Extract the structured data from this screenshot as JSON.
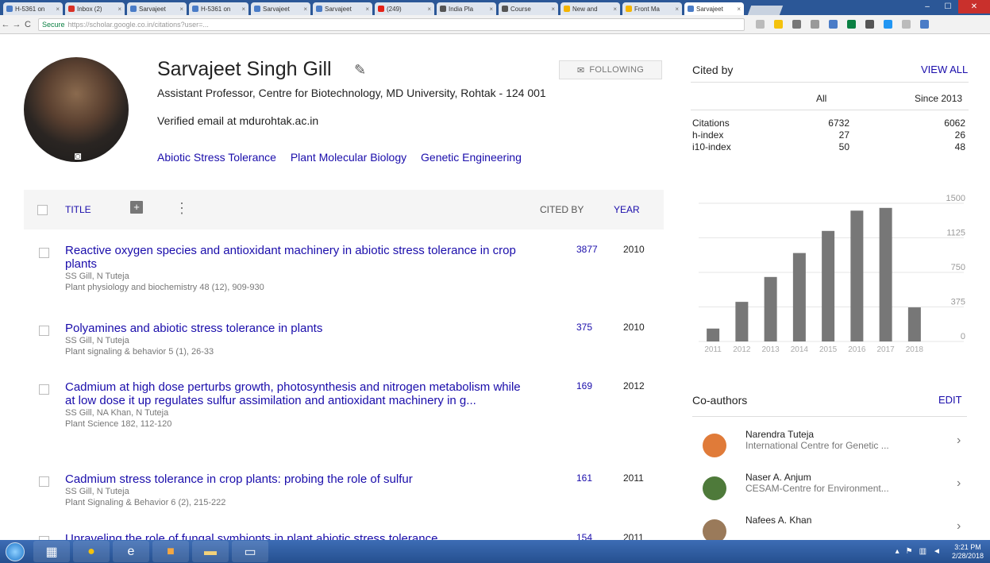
{
  "browser": {
    "tabs": [
      {
        "label": "H-5361 on",
        "color": "#4a7cc7"
      },
      {
        "label": "Inbox (2)",
        "color": "#d93025"
      },
      {
        "label": "Sarvajeet",
        "color": "#4a7cc7"
      },
      {
        "label": "H-5361 on",
        "color": "#4a7cc7"
      },
      {
        "label": "Sarvajeet",
        "color": "#4a7cc7"
      },
      {
        "label": "Sarvajeet",
        "color": "#4a7cc7"
      },
      {
        "label": "(249)",
        "color": "#e62117"
      },
      {
        "label": "India Pla",
        "color": "#555"
      },
      {
        "label": "Course",
        "color": "#555"
      },
      {
        "label": "New and",
        "color": "#f4b400"
      },
      {
        "label": "Front Ma",
        "color": "#f4b400"
      },
      {
        "label": "Sarvajeet",
        "color": "#4a7cc7",
        "active": true
      }
    ],
    "secure_label": "Secure",
    "url": "https://scholar.google.co.in/citations?user=..."
  },
  "profile": {
    "name": "Sarvajeet Singh Gill",
    "affiliation": "Assistant Professor, Centre for Biotechnology, MD University, Rohtak - 124 001",
    "email": "Verified email at mdurohtak.ac.in",
    "interests": [
      "Abiotic Stress Tolerance",
      "Plant Molecular Biology",
      "Genetic Engineering"
    ],
    "follow_label": "FOLLOWING"
  },
  "table": {
    "title_header": "TITLE",
    "cited_header": "CITED BY",
    "year_header": "YEAR",
    "rows": [
      {
        "title": "Reactive oxygen species and antioxidant machinery in abiotic stress tolerance in crop plants",
        "authors": "SS Gill, N Tuteja",
        "venue": "Plant physiology and biochemistry 48 (12), 909-930",
        "cited": "3877",
        "year": "2010"
      },
      {
        "title": "Polyamines and abiotic stress tolerance in plants",
        "authors": "SS Gill, N Tuteja",
        "venue": "Plant signaling & behavior 5 (1), 26-33",
        "cited": "375",
        "year": "2010"
      },
      {
        "title": "Cadmium at high dose perturbs growth, photosynthesis and nitrogen metabolism while at low dose it up regulates sulfur assimilation and antioxidant machinery in g...",
        "authors": "SS Gill, NA Khan, N Tuteja",
        "venue": "Plant Science 182, 112-120",
        "cited": "169",
        "year": "2012"
      },
      {
        "title": "Cadmium stress tolerance in crop plants: probing the role of sulfur",
        "authors": "SS Gill, N Tuteja",
        "venue": "Plant Signaling & Behavior 6 (2), 215-222",
        "cited": "161",
        "year": "2011"
      },
      {
        "title": "Unraveling the role of fungal symbionts in plant abiotic stress tolerance",
        "authors": "",
        "venue": "",
        "cited": "154",
        "year": "2011"
      }
    ]
  },
  "cited_by": {
    "title": "Cited by",
    "view_all": "VIEW ALL",
    "col_all": "All",
    "col_since": "Since 2013",
    "metrics": [
      {
        "label": "Citations",
        "all": "6732",
        "since": "6062"
      },
      {
        "label": "h-index",
        "all": "27",
        "since": "26"
      },
      {
        "label": "i10-index",
        "all": "50",
        "since": "48"
      }
    ]
  },
  "chart_data": {
    "type": "bar",
    "categories": [
      "2011",
      "2012",
      "2013",
      "2014",
      "2015",
      "2016",
      "2017",
      "2018"
    ],
    "values": [
      140,
      430,
      700,
      960,
      1200,
      1420,
      1450,
      370
    ],
    "ylim": [
      0,
      1500
    ],
    "yticks": [
      "0",
      "375",
      "750",
      "1125",
      "1500"
    ],
    "grid": true,
    "bar_color": "#777777"
  },
  "coauthors": {
    "title": "Co-authors",
    "edit": "EDIT",
    "items": [
      {
        "name": "Narendra Tuteja",
        "affiliation": "International Centre for Genetic ...",
        "color": "#e07b39"
      },
      {
        "name": "Naser A. Anjum",
        "affiliation": "CESAM-Centre for Environment...",
        "color": "#4e7a3a"
      },
      {
        "name": "Nafees A. Khan",
        "affiliation": "",
        "color": "#9a7a5a"
      }
    ]
  },
  "taskbar": {
    "time": "3:21 PM",
    "date": "2/28/2018"
  }
}
